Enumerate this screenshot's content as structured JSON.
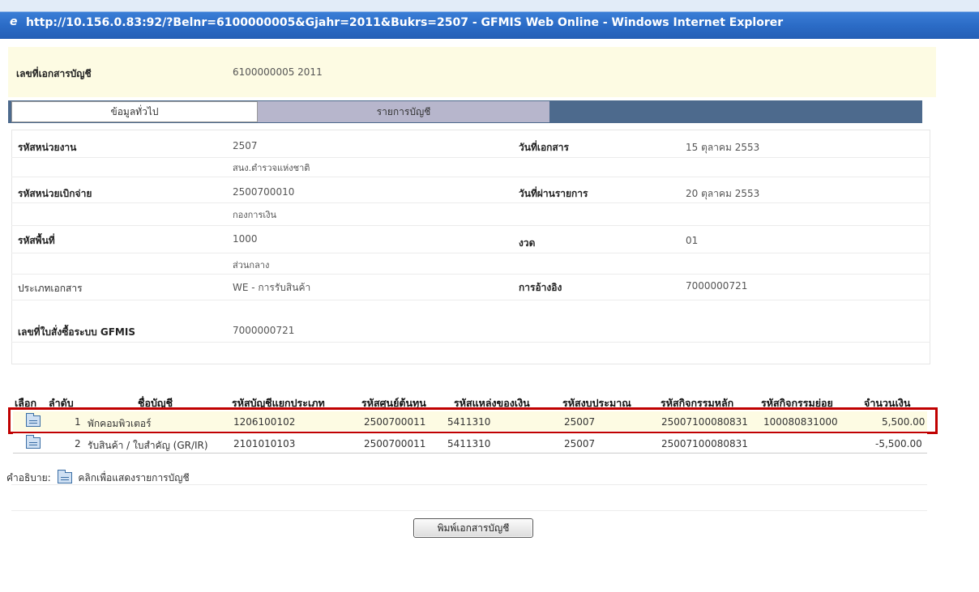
{
  "window": {
    "title": "http://10.156.0.83:92/?Belnr=6100000005&Gjahr=2011&Bukrs=2507 - GFMIS Web Online - Windows Internet Explorer"
  },
  "doc": {
    "label": "เลขที่เอกสารบัญชี",
    "value": "6100000005  2011"
  },
  "tabs": [
    {
      "label": "ข้อมูลทั่วไป",
      "active": true
    },
    {
      "label": "รายการบัญชี",
      "active": false
    }
  ],
  "general": {
    "dept_code_label": "รหัสหน่วยงาน",
    "dept_code": "2507",
    "dept_name": "สนง.ตำรวจแห่งชาติ",
    "doc_date_label": "วันที่เอกสาร",
    "doc_date": "15 ตุลาคม 2553",
    "disb_code_label": "รหัสหน่วยเบิกจ่าย",
    "disb_code": "2500700010",
    "disb_name": "กองการเงิน",
    "post_date_label": "วันที่ผ่านรายการ",
    "post_date": "20 ตุลาคม 2553",
    "area_code_label": "รหัสพื้นที่",
    "area_code": "1000",
    "area_name": "ส่วนกลาง",
    "period_label": "งวด",
    "period": "01",
    "doc_type_label": "ประเภทเอกสาร",
    "doc_type": "WE - การรับสินค้า",
    "reference_label": "การอ้างอิง",
    "reference": "7000000721",
    "po_label": "เลขที่ใบสั่งซื้อระบบ GFMIS",
    "po": "7000000721"
  },
  "table": {
    "headers": [
      "เลือก",
      "ลำดับ",
      "ชื่อบัญชี",
      "รหัสบัญชีแยกประเภท",
      "รหัสศูนย์ต้นทุน",
      "รหัสแหล่งของเงิน",
      "รหัสงบประมาณ",
      "รหัสกิจกรรมหลัก",
      "รหัสกิจกรรมย่อย",
      "จำนวนเงิน"
    ],
    "rows": [
      {
        "no": "1",
        "name": "พักคอมพิวเตอร์",
        "gl": "1206100102",
        "cost_center": "2500700011",
        "fund": "5411310",
        "budget": "25007",
        "main_activity": "25007100080831",
        "sub_activity": "100080831000",
        "amount": "5,500.00",
        "highlighted": true
      },
      {
        "no": "2",
        "name": "รับสินค้า / ใบสำคัญ (GR/IR)",
        "gl": "2101010103",
        "cost_center": "2500700011",
        "fund": "5411310",
        "budget": "25007",
        "main_activity": "25007100080831",
        "sub_activity": "",
        "amount": "-5,500.00",
        "highlighted": false
      }
    ]
  },
  "legend": {
    "prefix": "คำอธิบาย:",
    "text": "คลิกเพื่อแสดงรายการบัญชี"
  },
  "print_button": "พิมพ์เอกสารบัญชี",
  "colors": {
    "highlight_border": "#c00000",
    "tab_bar": "#4d6a8d",
    "doc_bar": "#fdfbe3"
  }
}
